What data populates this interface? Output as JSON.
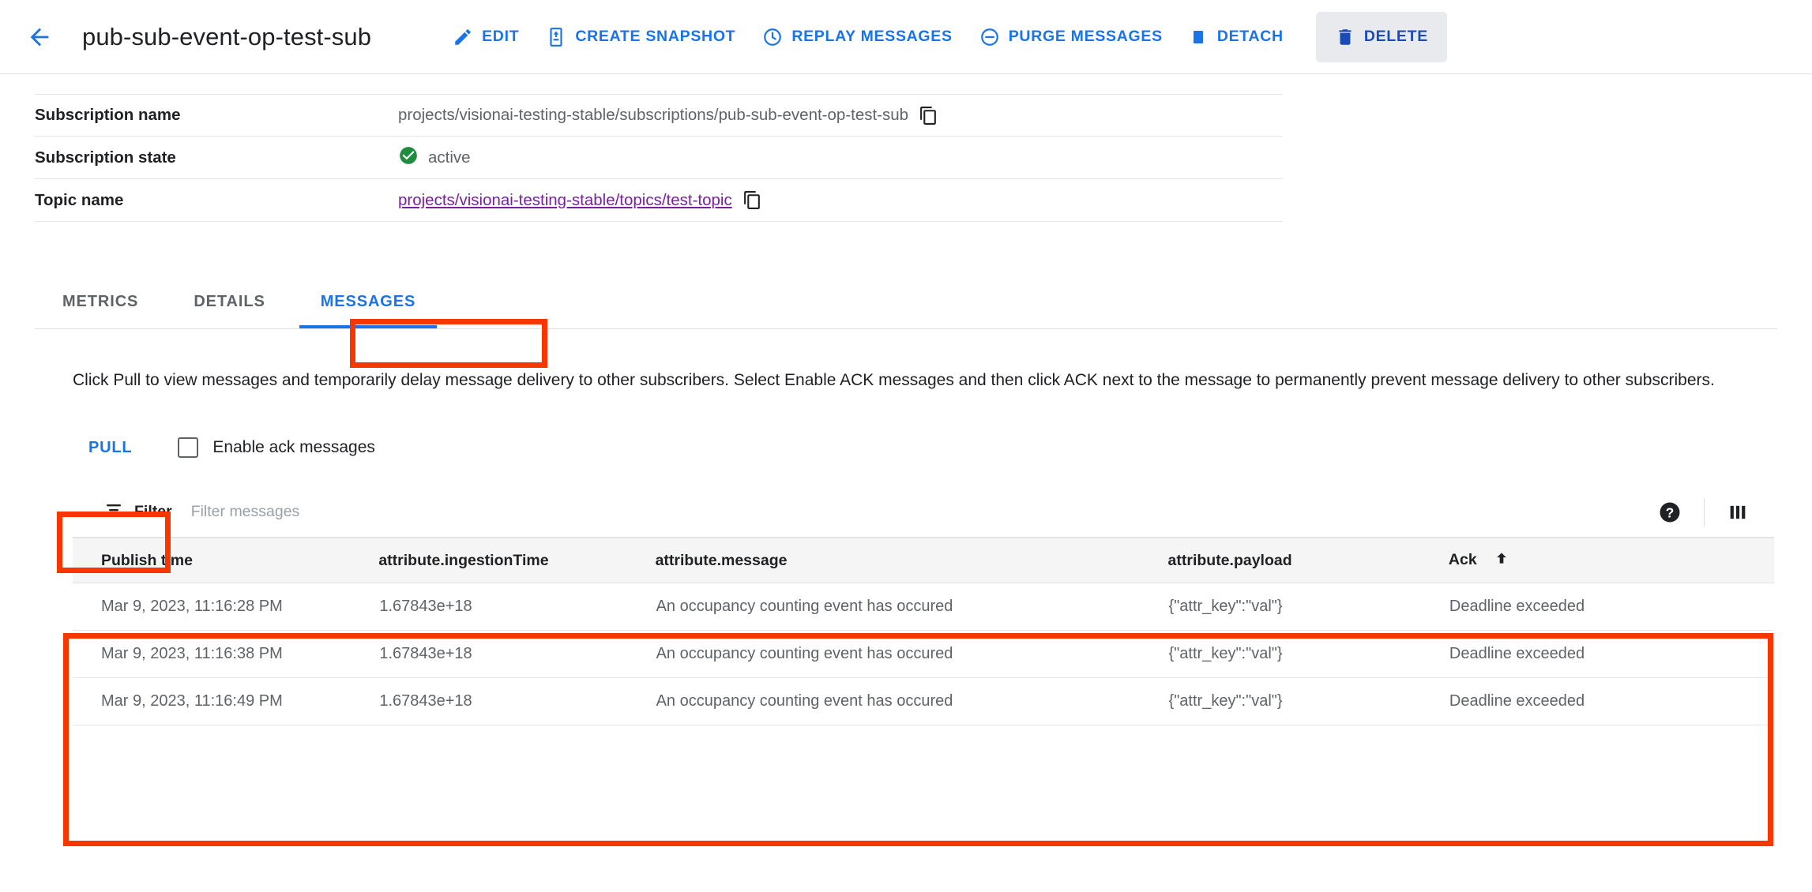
{
  "header": {
    "back_icon": "arrow-left-icon",
    "title": "pub-sub-event-op-test-sub",
    "actions": [
      {
        "id": "edit",
        "label": "EDIT",
        "icon": "pencil-icon"
      },
      {
        "id": "create-snapshot",
        "label": "CREATE SNAPSHOT",
        "icon": "snapshot-icon"
      },
      {
        "id": "replay-messages",
        "label": "REPLAY MESSAGES",
        "icon": "clock-icon"
      },
      {
        "id": "purge-messages",
        "label": "PURGE MESSAGES",
        "icon": "minus-circle-icon"
      },
      {
        "id": "detach",
        "label": "DETACH",
        "icon": "square-icon"
      },
      {
        "id": "delete",
        "label": "DELETE",
        "icon": "trash-icon"
      }
    ]
  },
  "properties": [
    {
      "key": "Subscription name",
      "value": "projects/visionai-testing-stable/subscriptions/pub-sub-event-op-test-sub",
      "copy": "copy-icon"
    },
    {
      "key": "Subscription state",
      "value": "active",
      "status_icon": "check-circle-icon"
    },
    {
      "key": "Topic name",
      "value": "projects/visionai-testing-stable/topics/test-topic",
      "copy": "copy-icon"
    }
  ],
  "tabs": [
    {
      "id": "metrics",
      "label": "METRICS",
      "active": false
    },
    {
      "id": "details",
      "label": "DETAILS",
      "active": false
    },
    {
      "id": "messages",
      "label": "MESSAGES",
      "active": true
    }
  ],
  "description": "Click Pull to view messages and temporarily delay message delivery to other subscribers. Select Enable ACK messages and then click ACK next to the message to permanently prevent message delivery to other subscribers.",
  "controls": {
    "pull_label": "PULL",
    "ack_checkbox_label": "Enable ack messages",
    "ack_checkbox_checked": false
  },
  "filter": {
    "icon": "filter-icon",
    "label": "Filter",
    "placeholder": "Filter messages",
    "help_icon": "help-circle-icon",
    "columns_icon": "column-settings-icon"
  },
  "table": {
    "columns": [
      "Publish time",
      "attribute.ingestionTime",
      "attribute.message",
      "attribute.payload",
      "Ack"
    ],
    "sorted_column": "Ack",
    "sort_direction": "ascending",
    "sort_icon": "arrow-up-icon",
    "rows": [
      {
        "publish_time": "Mar 9, 2023, 11:16:28 PM",
        "ingestion_time": "1.67843e+18",
        "message": "An occupancy counting event has occured",
        "payload": "{\"attr_key\":\"val\"}",
        "ack": "Deadline exceeded"
      },
      {
        "publish_time": "Mar 9, 2023, 11:16:38 PM",
        "ingestion_time": "1.67843e+18",
        "message": "An occupancy counting event has occured",
        "payload": "{\"attr_key\":\"val\"}",
        "ack": "Deadline exceeded"
      },
      {
        "publish_time": "Mar 9, 2023, 11:16:49 PM",
        "ingestion_time": "1.67843e+18",
        "message": "An occupancy counting event has occured",
        "payload": "{\"attr_key\":\"val\"}",
        "ack": "Deadline exceeded"
      }
    ]
  },
  "annotations": {
    "color": "#f83600",
    "boxes": [
      {
        "id": "messages-tab-highlight"
      },
      {
        "id": "pull-button-highlight"
      },
      {
        "id": "messages-table-highlight"
      }
    ]
  },
  "colors": {
    "accent": "#1a73e8",
    "link_visited": "#7b1fa2",
    "status_active": "#1e8e3e",
    "annotation": "#f83600"
  }
}
